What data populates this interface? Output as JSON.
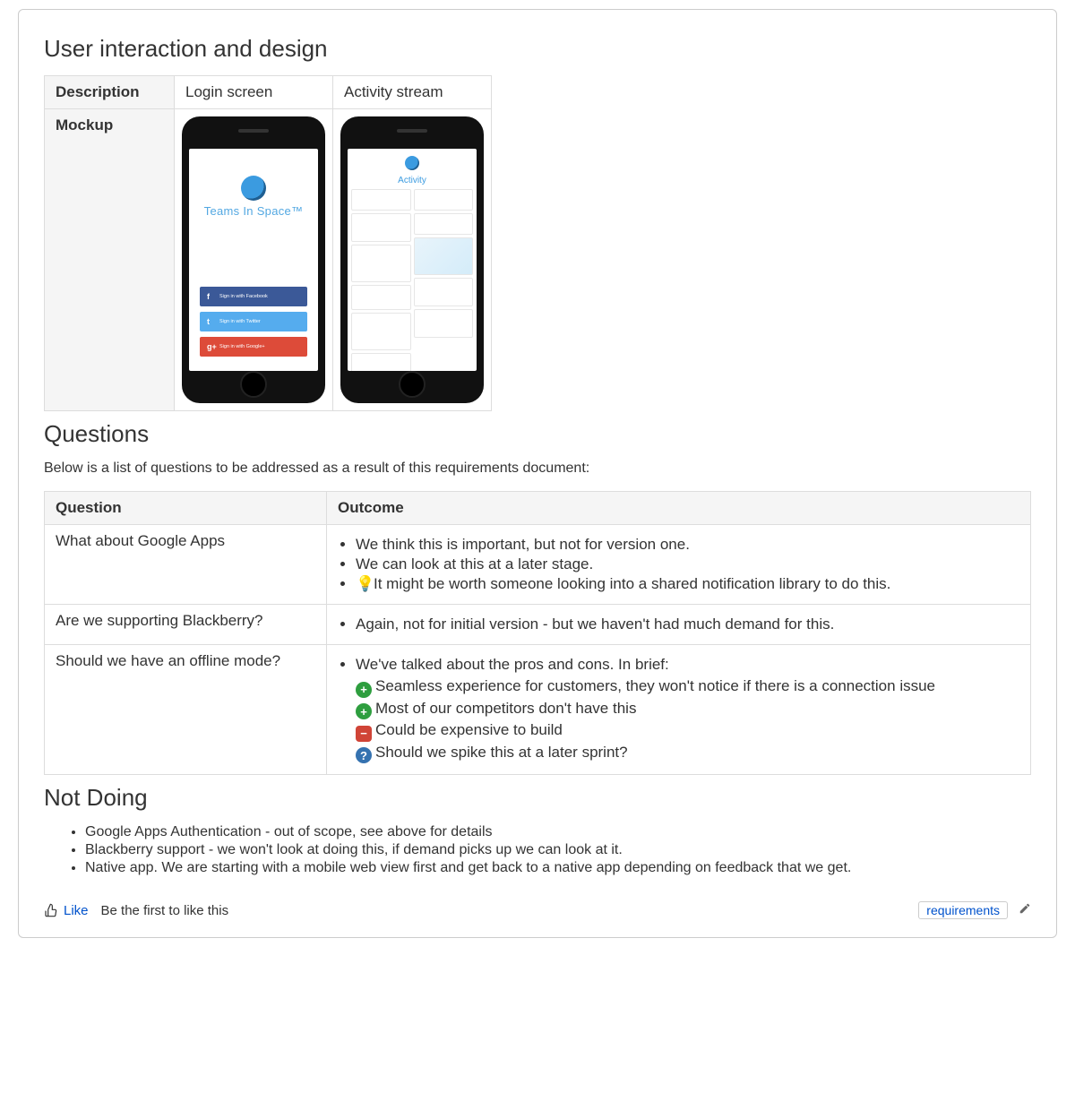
{
  "sections": {
    "design_heading": "User interaction and design",
    "questions_heading": "Questions",
    "questions_intro": "Below is a list of questions to be addressed as a result of this requirements document:",
    "notdoing_heading": "Not Doing"
  },
  "design_table": {
    "row1_label": "Description",
    "row2_label": "Mockup",
    "col1": "Login screen",
    "col2": "Activity stream"
  },
  "login_mock": {
    "app_name": "Teams In Space™",
    "fb": "Sign in with Facebook",
    "tw": "Sign in with Twitter",
    "gp": "Sign in with Google+"
  },
  "activity_mock": {
    "title": "Activity"
  },
  "questions_table": {
    "h1": "Question",
    "h2": "Outcome",
    "q1": "What about Google Apps",
    "q1_o1": "We think this is important, but not for version one.",
    "q1_o2": "We can look at this at a later stage.",
    "q1_o3": "It might be worth someone looking into a shared notification library to do this.",
    "q2": "Are we supporting Blackberry?",
    "q2_o1": "Again, not for initial version - but we haven't had much demand for this.",
    "q3": "Should we have an offline mode?",
    "q3_o1": "We've talked about the pros and cons. In brief:",
    "q3_s1": "Seamless experience for customers, they won't notice if there is a connection issue",
    "q3_s2": "Most of our competitors don't have this",
    "q3_s3": "Could be expensive to build",
    "q3_s4": "Should we spike this at a later sprint?"
  },
  "not_doing": {
    "i1": "Google Apps Authentication - out of scope, see above for details",
    "i2": "Blackberry support - we won't look at doing this, if demand picks up we can look at it.",
    "i3": "Native app. We are starting with a mobile web view first and get back to a native app depending on feedback that we get."
  },
  "footer": {
    "like": "Like",
    "like_hint": "Be the first to like this",
    "tag": "requirements"
  }
}
